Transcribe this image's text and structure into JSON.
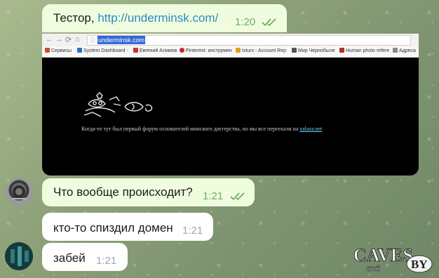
{
  "messages": [
    {
      "text": "Тестор, ",
      "link": "http://underminsk.com/",
      "time": "1:20"
    },
    {
      "text": "Что вообще происходит?",
      "time": "1:21"
    },
    {
      "text": "кто-то спиздил домен",
      "time": "1:21"
    },
    {
      "text": "забей",
      "time": "1:21"
    }
  ],
  "browser": {
    "url": "underminsk.com",
    "bookmarks": [
      {
        "label": "Сервисы",
        "color": "#d04a3a"
      },
      {
        "label": "System Dashboard -",
        "color": "#2a6fc8"
      },
      {
        "label": "Евгений Алимов",
        "color": "#cc3333"
      },
      {
        "label": "Pinterest: инструмен",
        "color": "#c8232c"
      },
      {
        "label": "txturs - Account Rep",
        "color": "#e0a020"
      },
      {
        "label": "Мир Чернобыле",
        "color": "#555"
      },
      {
        "label": "Human photo refere",
        "color": "#b03030"
      },
      {
        "label": "Адреса",
        "color": "#888"
      }
    ],
    "page_text": "Когда-то тут был первый форум основателей минского диггерства, но мы все переехали на ",
    "page_link": "zalaza.net"
  },
  "watermark": {
    "main": "CAVES",
    "small": "anti",
    "suffix": "BY"
  },
  "colors": {
    "outgoing": "#effdde",
    "incoming": "#ffffff",
    "link": "#2f87c6",
    "check": "#6cad5f"
  }
}
